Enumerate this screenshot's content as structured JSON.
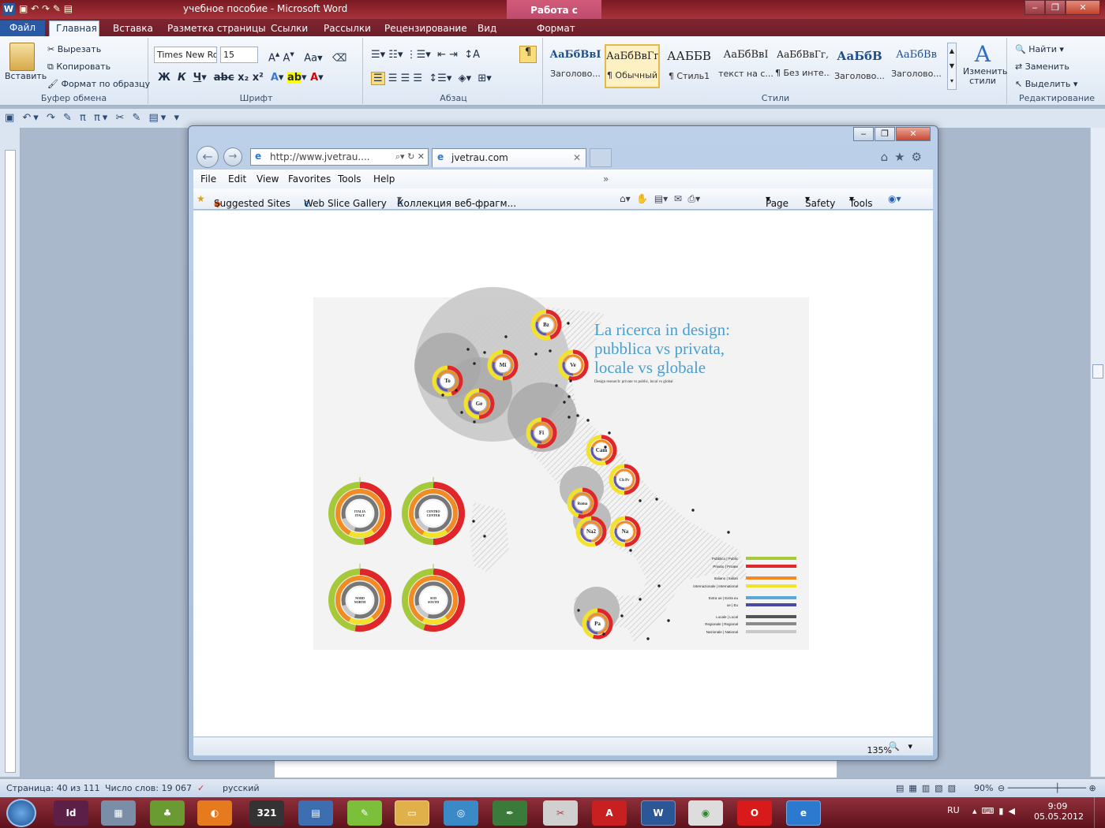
{
  "word": {
    "window_title": "учебное пособие  -  Microsoft Word",
    "contextual_tab": "Работа с рисунками",
    "tabs": [
      "Файл",
      "Главная",
      "Вставка",
      "Разметка страницы",
      "Ссылки",
      "Рассылки",
      "Рецензирование",
      "Вид",
      "Формат"
    ],
    "clipboard": {
      "paste": "Вставить",
      "cut": "Вырезать",
      "copy": "Копировать",
      "format_painter": "Формат по образцу",
      "label": "Буфер обмена"
    },
    "font": {
      "name": "Times New Ro",
      "size": "15",
      "label": "Шрифт"
    },
    "paragraph_label": "Абзац",
    "styles": [
      {
        "sample": "АаБбВвІ",
        "name": "Заголово..."
      },
      {
        "sample": "АаБбВвГг,",
        "name": "¶ Обычный"
      },
      {
        "sample": "ААББВ",
        "name": "¶ Стиль1"
      },
      {
        "sample": "АаБбВвІ",
        "name": "текст на с..."
      },
      {
        "sample": "АаБбВвГг,",
        "name": "¶ Без инте..."
      },
      {
        "sample": "АаБбВ",
        "name": "Заголово..."
      },
      {
        "sample": "АаБбВв",
        "name": "Заголово..."
      }
    ],
    "styles_label": "Стили",
    "change_styles": "Изменить стили",
    "editing": {
      "find": "Найти",
      "replace": "Заменить",
      "select": "Выделить",
      "label": "Редактирование"
    },
    "status": {
      "page": "Страница: 40 из 111",
      "words": "Число слов: 19 067",
      "language": "русский",
      "zoom": "90%"
    }
  },
  "ie": {
    "address": "http://www.jvetrau....",
    "tab_title": "jvetrau.com",
    "menu": [
      "File",
      "Edit",
      "View",
      "Favorites",
      "Tools",
      "Help"
    ],
    "favorites": [
      "Suggested Sites",
      "Web Slice Gallery",
      "Коллекция веб-фрагм..."
    ],
    "commands": [
      "Page",
      "Safety",
      "Tools"
    ],
    "zoom": "135%"
  },
  "infographic": {
    "title_lines": [
      "La ricerca in design:",
      "pubblica vs privata,",
      "locale vs globale"
    ],
    "subtitle": "Design research: private vs public, local vs global",
    "cities": [
      "Bz",
      "Mi",
      "Ve",
      "To",
      "Ge",
      "Fi",
      "Cam",
      "Ch Pr",
      "Roma",
      "Na2",
      "Na",
      "Pa"
    ],
    "big_donuts": [
      "ITALIA ITALY",
      "CENTRO CENTER",
      "NORD NORTH",
      "SUD SOUTH"
    ],
    "legend": [
      {
        "label": "Pubblico | Public",
        "color": "#a6c93a"
      },
      {
        "label": "Privato | Private",
        "color": "#e0262b"
      },
      {
        "label": "Italiano | Italian",
        "color": "#f08c23"
      },
      {
        "label": "Internazionale | International",
        "color": "#f2e22a"
      },
      {
        "label": "Extra ue | Extra eu",
        "color": "#5aa8d8"
      },
      {
        "label": "ue | Eu",
        "color": "#4a4aa0"
      },
      {
        "label": "Locale | Local",
        "color": "#555555"
      },
      {
        "label": "Regionale | Regional",
        "color": "#8a8a8a"
      },
      {
        "label": "Nazionale | National",
        "color": "#c8c8c8"
      }
    ]
  },
  "taskbar": {
    "lang": "RU",
    "time": "9:09",
    "date": "05.05.2012"
  },
  "colors": {
    "title_blue": "#4a9fcf",
    "word_title_red": "#8e2430"
  }
}
